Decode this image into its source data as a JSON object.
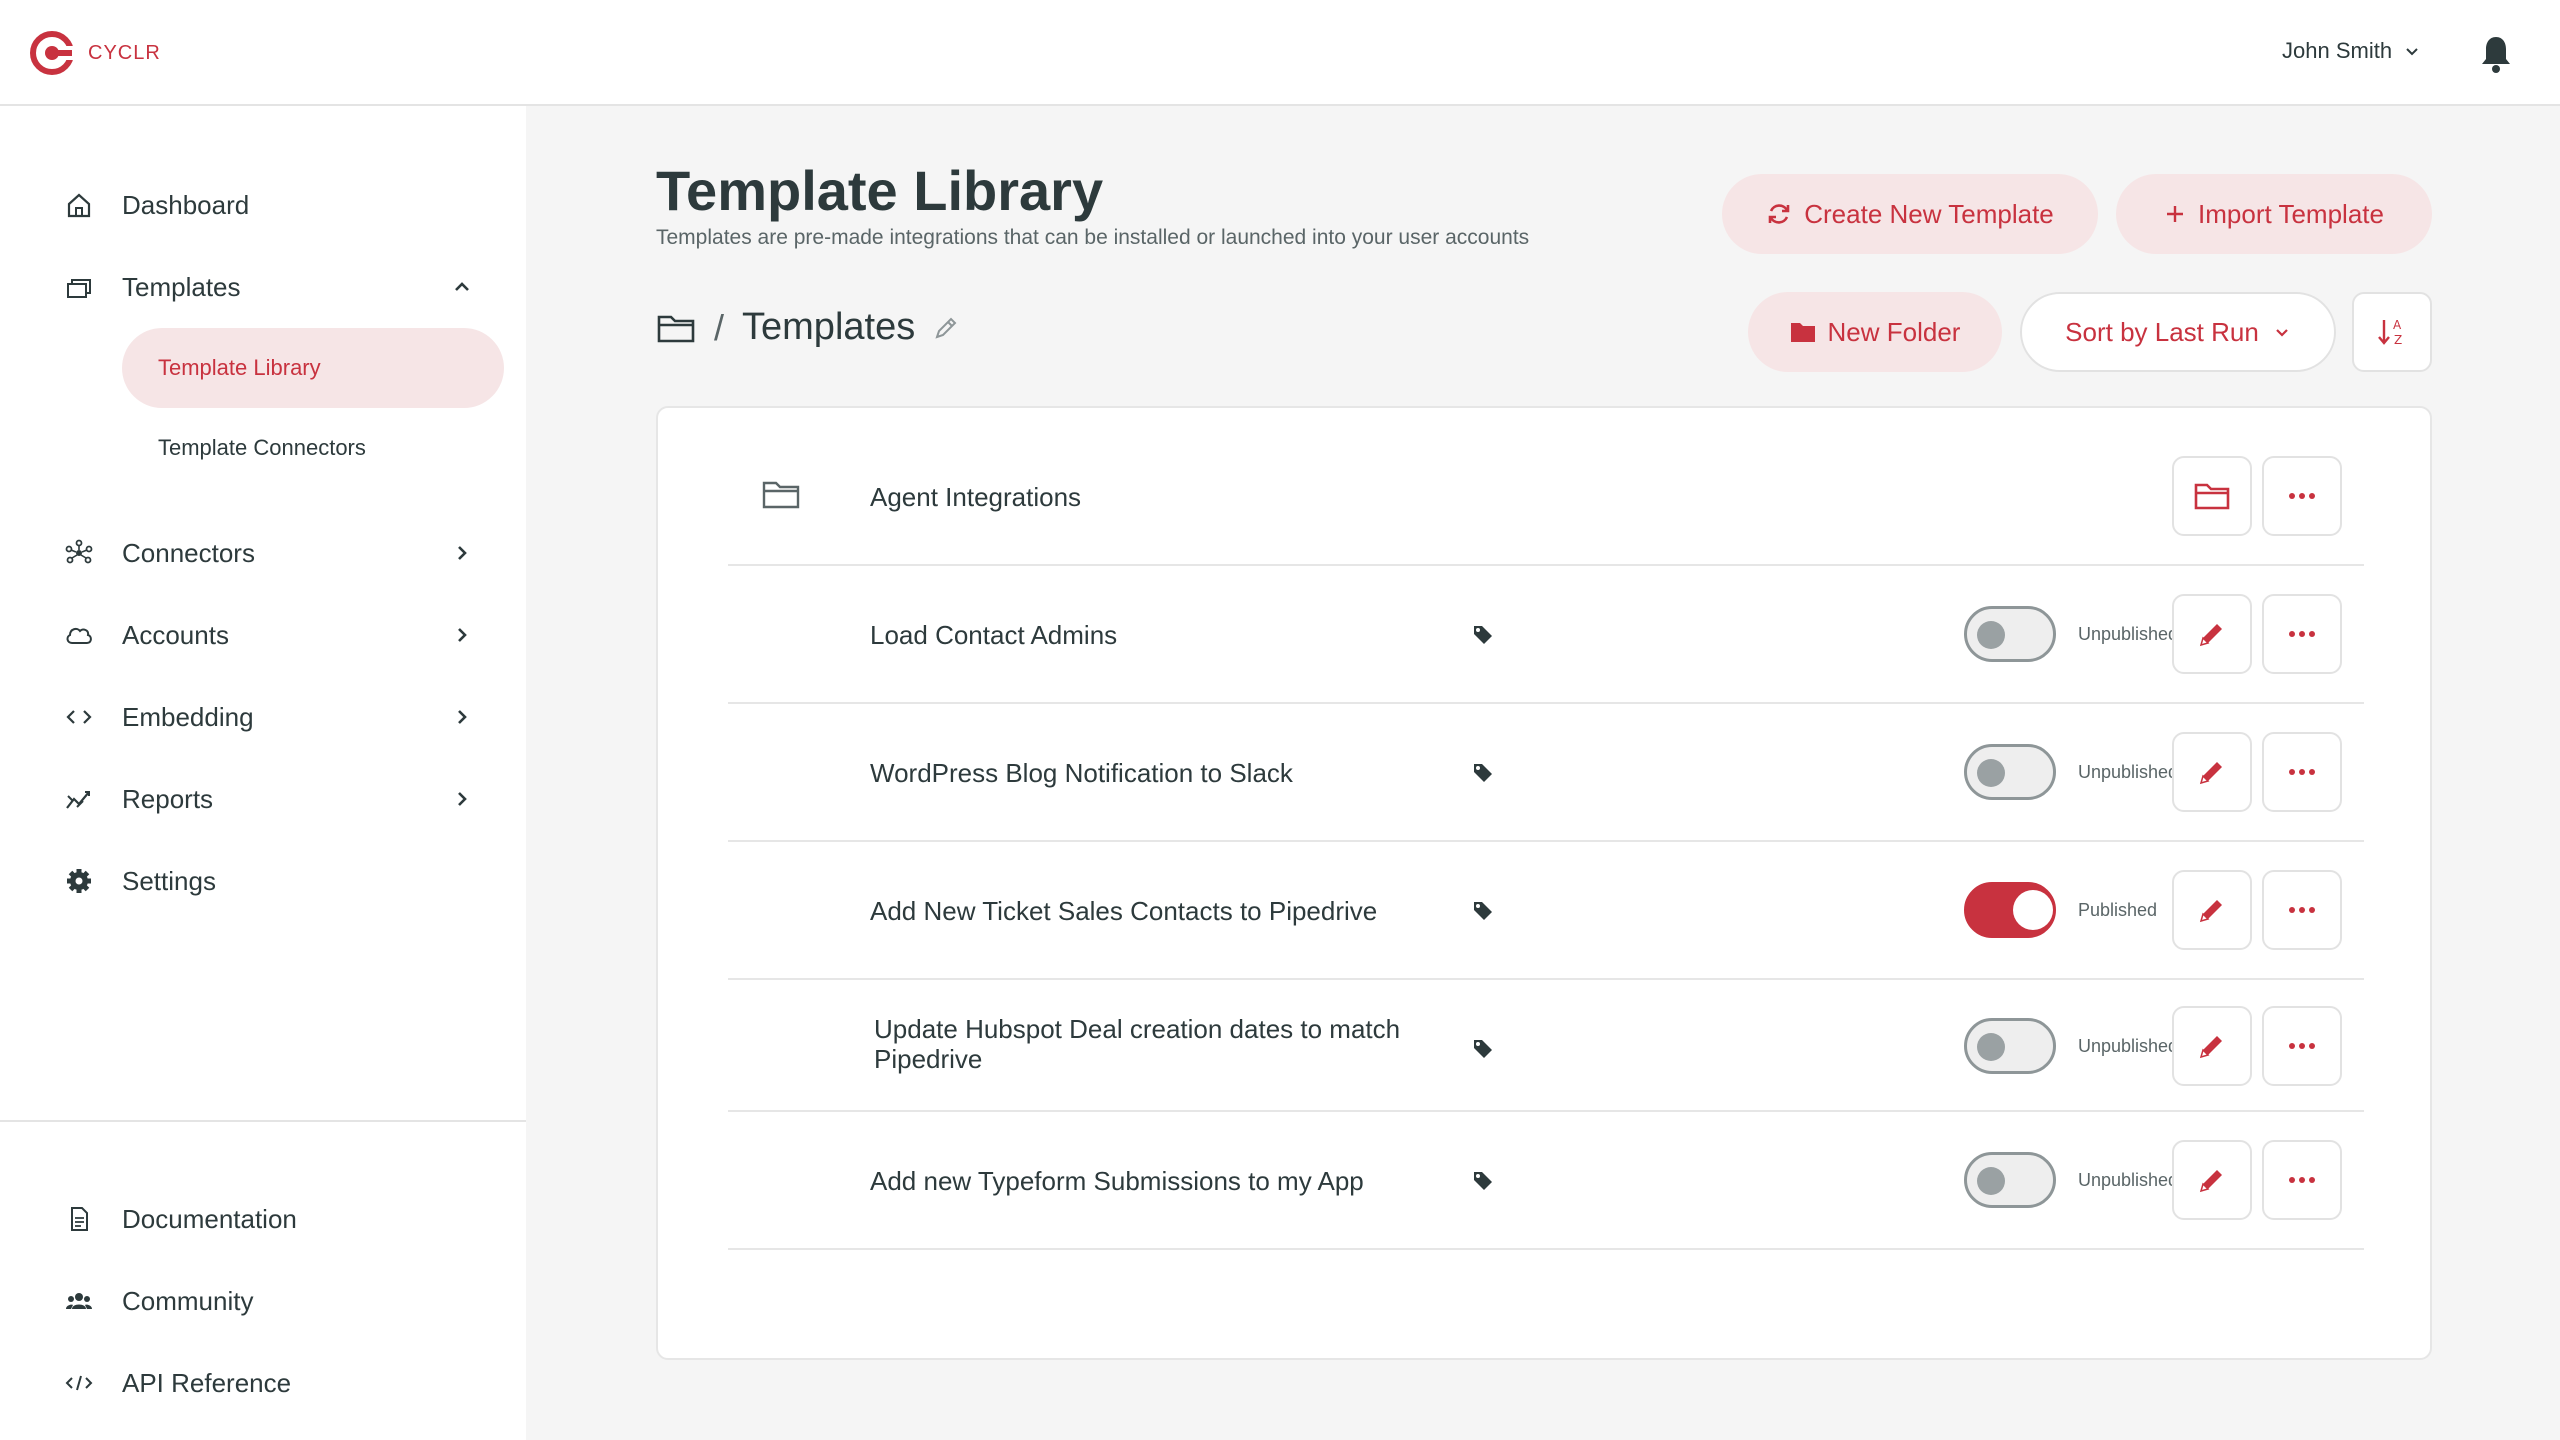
{
  "brand": {
    "name": "CYCLR",
    "color": "#c8323f"
  },
  "header": {
    "user_name": "John Smith"
  },
  "sidebar": {
    "items": [
      {
        "label": "Dashboard",
        "icon": "home-icon"
      },
      {
        "label": "Templates",
        "icon": "templates-icon",
        "expanded": true,
        "children": [
          {
            "label": "Template Library",
            "active": true
          },
          {
            "label": "Template Connectors",
            "active": false
          }
        ]
      },
      {
        "label": "Connectors",
        "icon": "connectors-icon"
      },
      {
        "label": "Accounts",
        "icon": "cloud-icon"
      },
      {
        "label": "Embedding",
        "icon": "code-icon"
      },
      {
        "label": "Reports",
        "icon": "reports-icon"
      },
      {
        "label": "Settings",
        "icon": "gear-icon"
      }
    ],
    "footer": [
      {
        "label": "Documentation",
        "icon": "document-icon"
      },
      {
        "label": "Community",
        "icon": "community-icon"
      },
      {
        "label": "API Reference",
        "icon": "api-icon"
      }
    ]
  },
  "page": {
    "title": "Template Library",
    "subtitle": "Templates are pre-made integrations that can be installed or launched into your user accounts",
    "create_label": "Create New Template",
    "import_label": "Import Template"
  },
  "toolbar": {
    "breadcrumb_separator": "/",
    "breadcrumb_title": "Templates",
    "new_folder_label": "New Folder",
    "sort_label": "Sort by Last Run"
  },
  "list": {
    "folder": {
      "name": "Agent Integrations"
    },
    "templates": [
      {
        "name": "Load Contact Admins",
        "status": "Unpublished",
        "published": false
      },
      {
        "name": "WordPress Blog Notification to Slack",
        "status": "Unpublished",
        "published": false
      },
      {
        "name": "Add New Ticket Sales Contacts to Pipedrive",
        "status": "Published",
        "published": true
      },
      {
        "name": "Update Hubspot Deal creation dates to match Pipedrive",
        "status": "Unpublished",
        "published": false
      },
      {
        "name": "Add new Typeform Submissions to my App",
        "status": "Unpublished",
        "published": false
      }
    ]
  }
}
